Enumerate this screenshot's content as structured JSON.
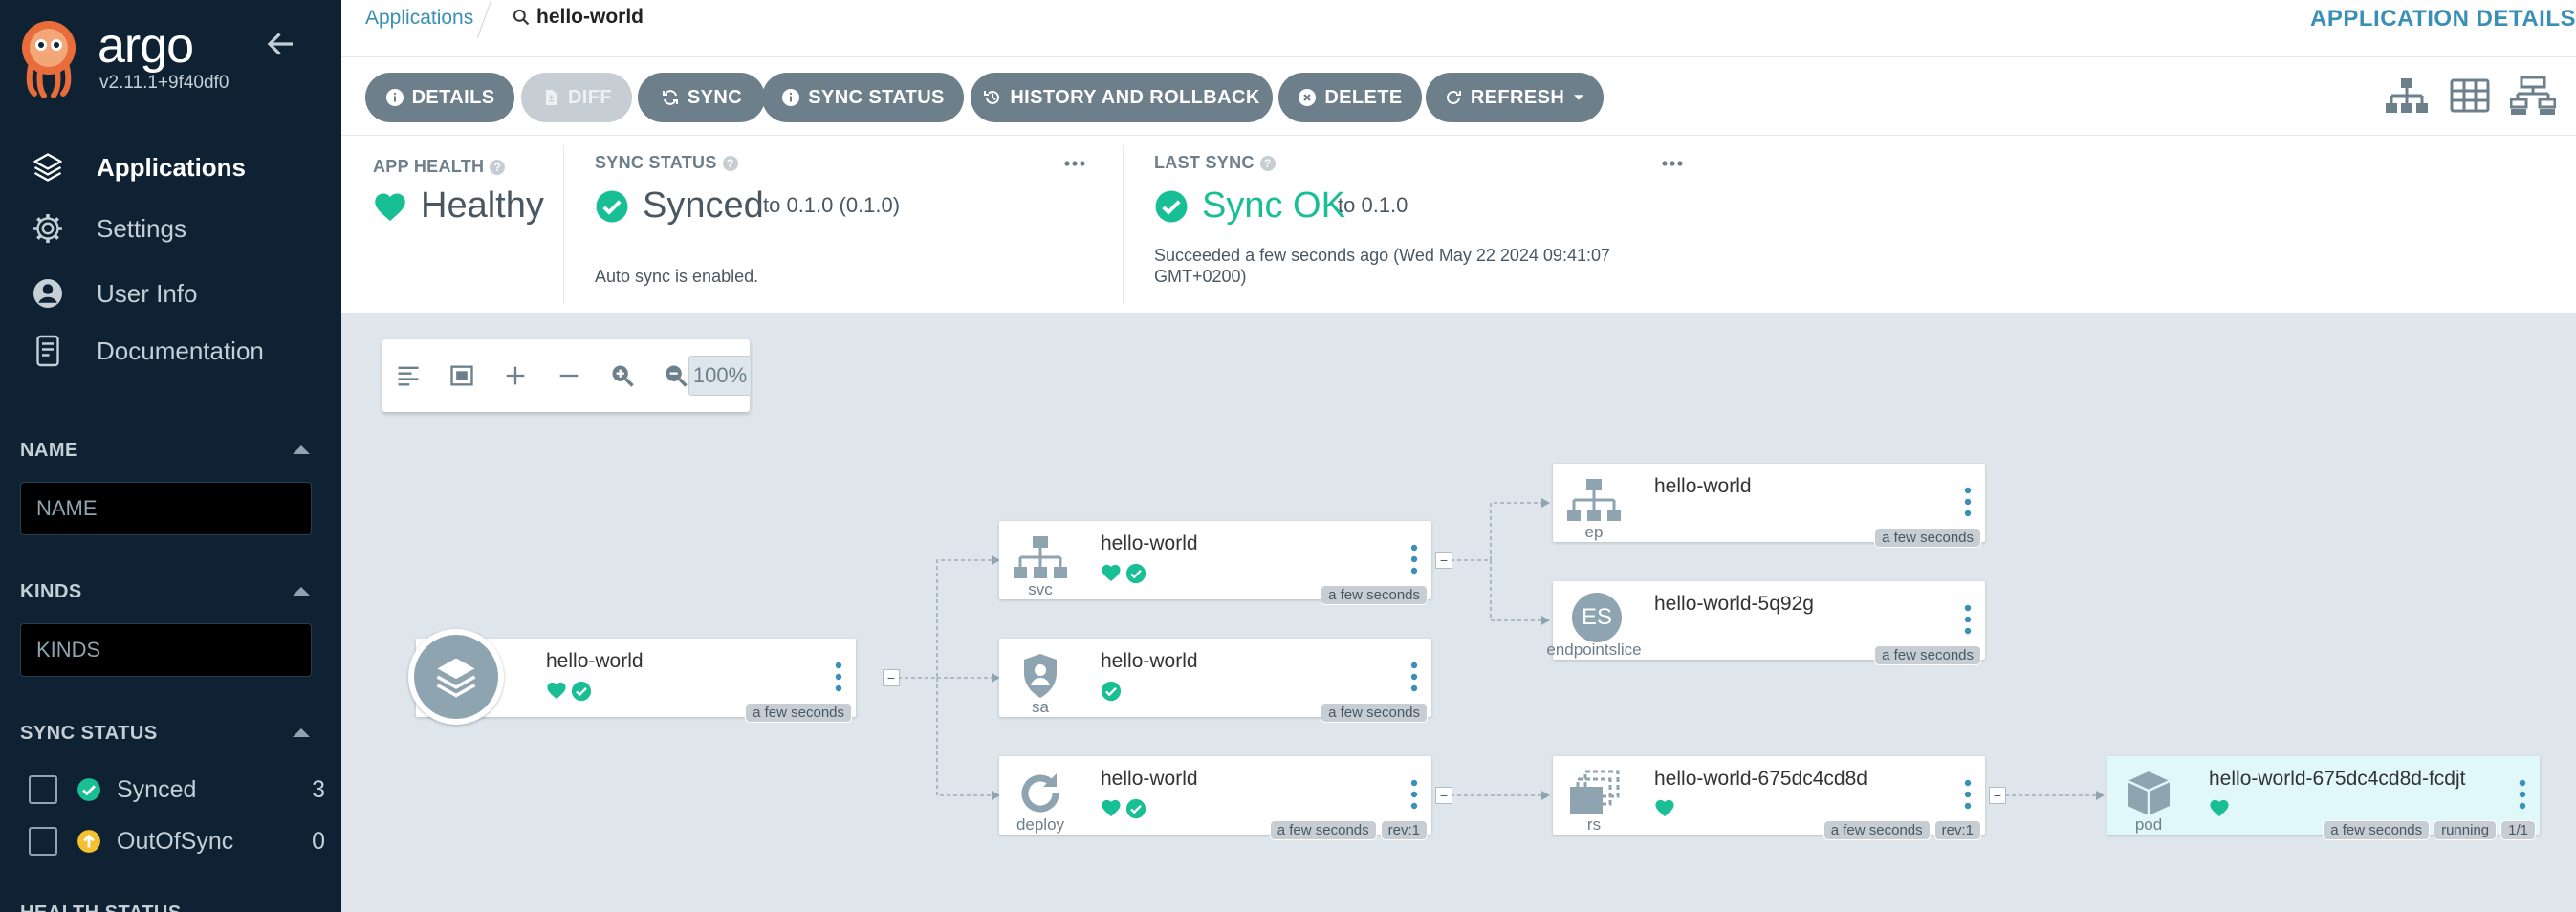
{
  "app": {
    "brand": "argo",
    "version": "v2.11.1+9f40df0"
  },
  "sidebar": {
    "nav": [
      {
        "label": "Applications",
        "icon": "layers-icon",
        "active": true
      },
      {
        "label": "Settings",
        "icon": "gear-icon",
        "active": false
      },
      {
        "label": "User Info",
        "icon": "user-icon",
        "active": false
      },
      {
        "label": "Documentation",
        "icon": "document-icon",
        "active": false
      }
    ],
    "filters": {
      "name": {
        "title": "NAME",
        "placeholder": "NAME"
      },
      "kinds": {
        "title": "KINDS",
        "placeholder": "KINDS"
      },
      "sync_status": {
        "title": "SYNC STATUS",
        "options": [
          {
            "label": "Synced",
            "count": "3",
            "color": "#18be94"
          },
          {
            "label": "OutOfSync",
            "count": "0",
            "color": "#f4c030"
          }
        ]
      },
      "health_status_title": "HEALTH STATUS"
    }
  },
  "topbar": {
    "breadcrumb": "Applications",
    "app_name": "hello-world",
    "right_title": "APPLICATION DETAILS"
  },
  "toolbar": {
    "buttons": [
      {
        "label": "DETAILS",
        "icon": "info-icon"
      },
      {
        "label": "DIFF",
        "icon": "file-icon",
        "disabled": true
      },
      {
        "label": "SYNC",
        "icon": "sync-icon"
      },
      {
        "label": "SYNC STATUS",
        "icon": "info-icon"
      },
      {
        "label": "HISTORY AND ROLLBACK",
        "icon": "history-icon"
      },
      {
        "label": "DELETE",
        "icon": "close-circle-icon"
      },
      {
        "label": "REFRESH",
        "icon": "refresh-icon"
      }
    ]
  },
  "status": {
    "app_health": {
      "label": "APP HEALTH",
      "value": "Healthy"
    },
    "sync_status": {
      "label": "SYNC STATUS",
      "value": "Synced",
      "target": "to 0.1.0 (0.1.0)",
      "note": "Auto sync is enabled."
    },
    "last_sync": {
      "label": "LAST SYNC",
      "value": "Sync OK",
      "target": "to 0.1.0",
      "detail_1": "Succeeded a few seconds ago (Wed May 22 2024 09:41:07",
      "detail_2": "GMT+0200)"
    },
    "colors": {
      "healthy": "#18be94",
      "accent": "#3a8fb6"
    }
  },
  "canvas": {
    "zoom": "100%",
    "nodes": {
      "app": {
        "name": "hello-world",
        "age": "a few seconds"
      },
      "svc": {
        "name": "hello-world",
        "kind": "svc",
        "age": "a few seconds"
      },
      "sa": {
        "name": "hello-world",
        "kind": "sa",
        "age": "a few seconds"
      },
      "deploy": {
        "name": "hello-world",
        "kind": "deploy",
        "age": "a few seconds",
        "rev": "rev:1"
      },
      "ep": {
        "name": "hello-world",
        "kind": "ep",
        "age": "a few seconds"
      },
      "es": {
        "name": "hello-world-5q92g",
        "kind": "endpointslice",
        "badge": "ES",
        "age": "a few seconds"
      },
      "rs": {
        "name": "hello-world-675dc4cd8d",
        "kind": "rs",
        "age": "a few seconds",
        "rev": "rev:1"
      },
      "pod": {
        "name": "hello-world-675dc4cd8d-fcdjt",
        "kind": "pod",
        "age": "a few seconds",
        "state": "running",
        "ready": "1/1"
      }
    }
  }
}
